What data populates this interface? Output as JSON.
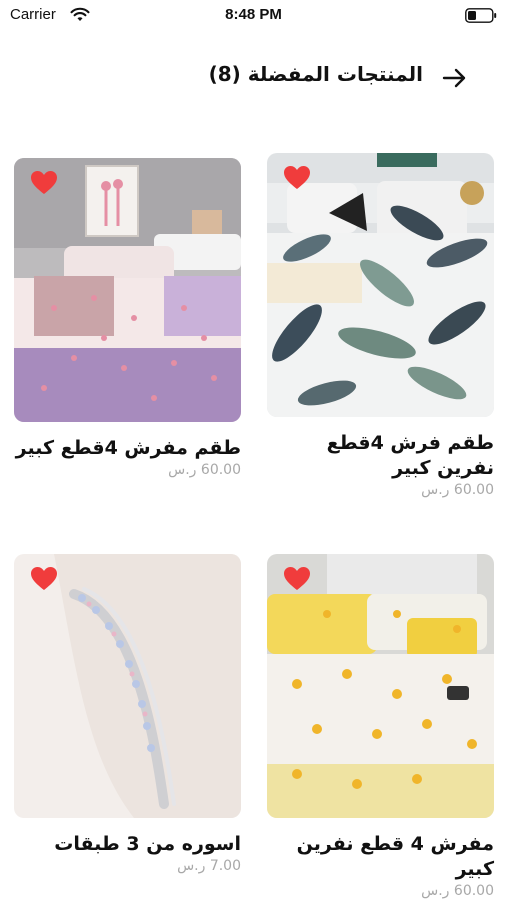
{
  "status_bar": {
    "carrier": "Carrier",
    "time": "8:48 PM",
    "icons": [
      "wifi-icon",
      "battery-icon"
    ]
  },
  "header": {
    "title": "المنتجات المفضلة (8)",
    "back_icon": "arrow-right-icon"
  },
  "colors": {
    "heart": "#f03c3c",
    "price": "#a8a8a8",
    "text": "#111111"
  },
  "products": [
    {
      "name": "طقم فرش 4قطع نفرين كبير",
      "price": "60.00 ر.س",
      "favorite": true
    },
    {
      "name": "طقم مفرش 4قطع كبير",
      "price": "60.00 ر.س",
      "favorite": true
    },
    {
      "name": "مفرش 4 قطع نفرين كبير",
      "price": "60.00 ر.س",
      "favorite": true
    },
    {
      "name": "اسوره من 3 طبقات",
      "price": "7.00 ر.س",
      "favorite": true
    }
  ]
}
